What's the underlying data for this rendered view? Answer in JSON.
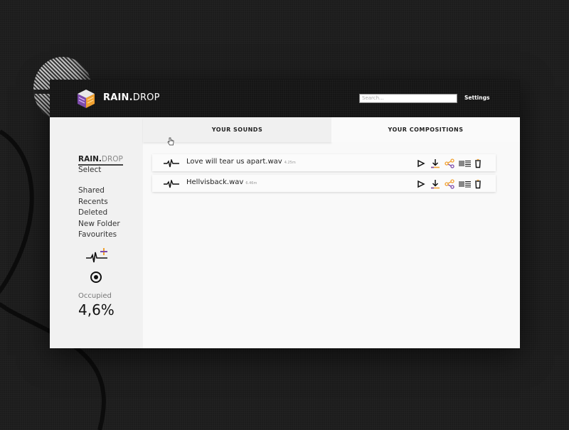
{
  "app": {
    "brand_bold": "RAIN.",
    "brand_light": "DROP",
    "accent_colors": {
      "purple": "#7d4bab",
      "orange": "#f0a030"
    }
  },
  "topbar": {
    "search_placeholder": "Search...",
    "settings_label": "Settings"
  },
  "sidebar": {
    "brand_bold": "RAIN.",
    "brand_light": "DROP",
    "select_label": "Select",
    "nav": [
      "Shared",
      "Recents",
      "Deleted",
      "New Folder",
      "Favourites"
    ],
    "add_sound_icon": "waveform-plus-icon",
    "record_icon": "record-target-icon",
    "occupied_label": "Occupied",
    "occupied_value": "4,6%"
  },
  "tabs": [
    {
      "label": "YOUR SOUNDS",
      "active": true
    },
    {
      "label": "YOUR COMPOSITIONS",
      "active": false
    }
  ],
  "files": [
    {
      "name": "Love will tear us apart.wav",
      "duration": "4.25m"
    },
    {
      "name": "Hellvisback.wav",
      "duration": "6.46m"
    }
  ],
  "file_actions": [
    "play-icon",
    "download-icon",
    "share-icon",
    "waveform-list-icon",
    "trash-icon"
  ]
}
